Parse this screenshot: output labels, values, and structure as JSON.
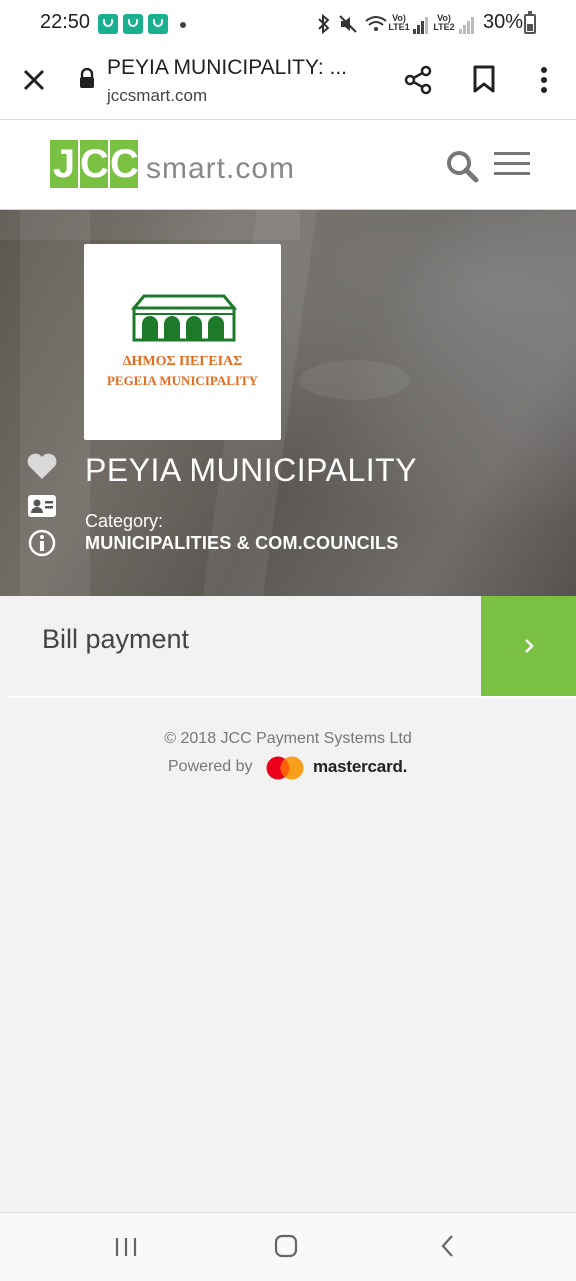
{
  "status_bar": {
    "time": "22:50",
    "net1": "Vo)\nLTE1",
    "net2": "Vo)\nLTE2",
    "battery": "30%"
  },
  "browser": {
    "title": "PEYIA MUNICIPALITY: ...",
    "url": "jccsmart.com"
  },
  "site": {
    "logo_boxes": [
      "J",
      "C",
      "C"
    ],
    "logo_rest": "smart.com"
  },
  "merchant": {
    "logo_text_greek": "ΔΗΜΟΣ ΠΕΓΕΙΑΣ",
    "logo_text_en": "PEGEIA MUNICIPALITY",
    "name": "PEYIA MUNICIPALITY",
    "category_label": "Category:",
    "category_value": "MUNICIPALITIES & COM.COUNCILS"
  },
  "actions": {
    "bill_payment": "Bill payment"
  },
  "footer": {
    "copyright": "© 2018 JCC Payment Systems Ltd",
    "powered_by": "Powered by",
    "brand": "mastercard."
  },
  "colors": {
    "accent_green": "#7ac143",
    "logo_orange": "#e66a1d"
  }
}
